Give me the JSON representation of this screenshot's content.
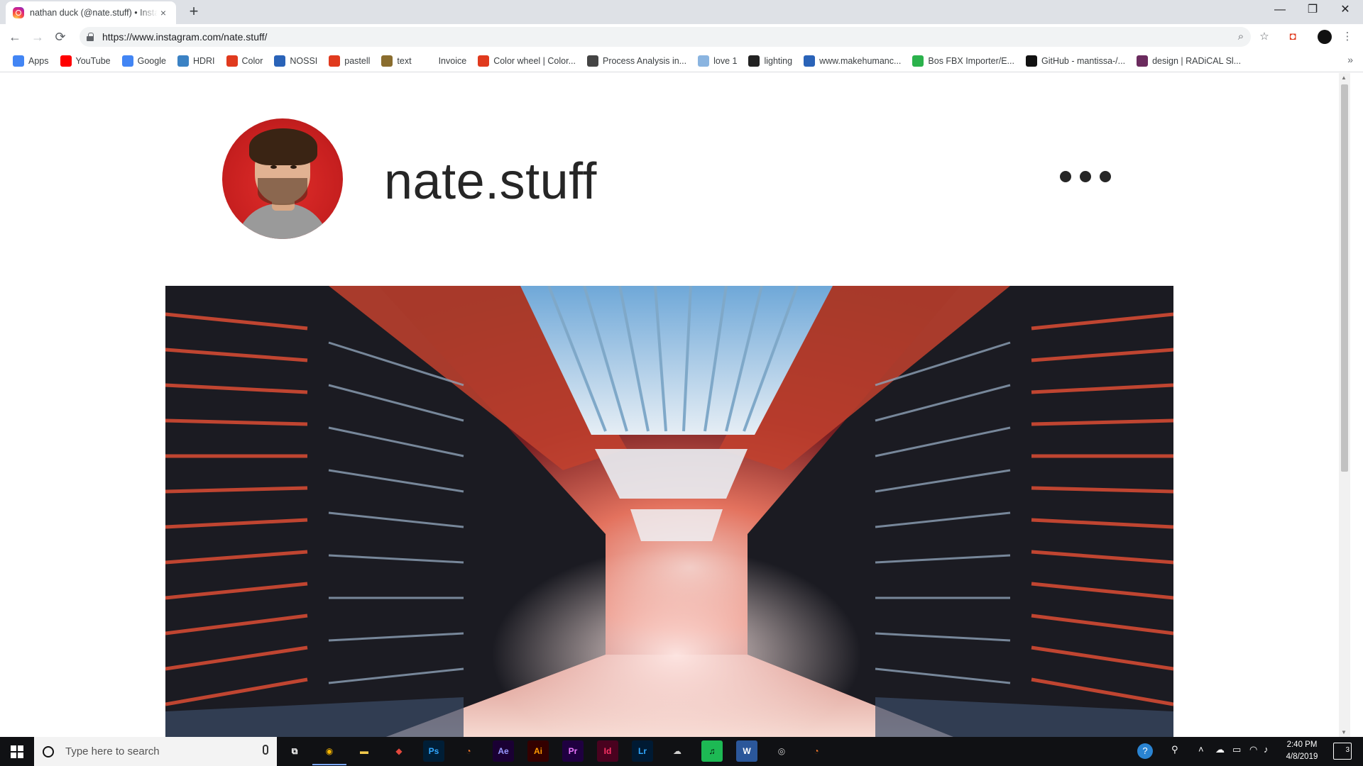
{
  "browser": {
    "tab_title": "nathan duck (@nate.stuff) • Instagram photos and videos",
    "new_tab": "+",
    "tab_close": "×",
    "url": "https://www.instagram.com/nate.stuff/",
    "window_controls": {
      "minimize": "—",
      "restore": "❐",
      "close": "✕"
    },
    "nav": {
      "back": "←",
      "forward": "→",
      "reload": "⟳"
    },
    "toolbar_icons": {
      "zoom": "⌕",
      "star": "☆",
      "extension": "◘",
      "menu": "⋮"
    }
  },
  "bookmarks": [
    {
      "label": "Apps",
      "icon": "apps-grid-icon",
      "color": "#4285f4"
    },
    {
      "label": "YouTube",
      "icon": "youtube-icon",
      "color": "#ff0000"
    },
    {
      "label": "Google",
      "icon": "google-icon",
      "color": "#4285f4"
    },
    {
      "label": "HDRI",
      "icon": "hdri-icon",
      "color": "#3b82c4"
    },
    {
      "label": "Color",
      "icon": "adobe-icon",
      "color": "#e03a1e"
    },
    {
      "label": "NOSSI",
      "icon": "nossi-icon",
      "color": "#2a63b8"
    },
    {
      "label": "pastell",
      "icon": "adobe-icon",
      "color": "#e03a1e"
    },
    {
      "label": "text",
      "icon": "text-icon",
      "color": "#8a6d2e"
    },
    {
      "label": "Invoice",
      "icon": "blank-icon",
      "color": "#ffffff"
    },
    {
      "label": "Color wheel | Color...",
      "icon": "adobe-icon",
      "color": "#e03a1e"
    },
    {
      "label": "Process Analysis in...",
      "icon": "process-icon",
      "color": "#444444"
    },
    {
      "label": "love 1",
      "icon": "heart-icon",
      "color": "#8ab4e0"
    },
    {
      "label": "lighting",
      "icon": "lighting-icon",
      "color": "#222222"
    },
    {
      "label": "www.makehumanc...",
      "icon": "makehuman-icon",
      "color": "#2a63b8"
    },
    {
      "label": "Bos FBX Importer/E...",
      "icon": "bos-icon",
      "color": "#2bb24c"
    },
    {
      "label": "GitHub - mantissa-/...",
      "icon": "github-icon",
      "color": "#111111"
    },
    {
      "label": "design | RADiCAL Sl...",
      "icon": "radical-icon",
      "color": "#6b2b5e"
    }
  ],
  "bookmarks_more": "»",
  "profile": {
    "username": "nate.stuff",
    "options_icon": "more-options-icon"
  },
  "taskbar": {
    "search_placeholder": "Type here to search",
    "apps": [
      {
        "name": "task-view",
        "label": "⧉",
        "bg": "transparent",
        "fg": "#ffffff"
      },
      {
        "name": "chrome",
        "label": "◉",
        "bg": "transparent",
        "fg": "#f4b400",
        "active": true
      },
      {
        "name": "file-explorer",
        "label": "▬",
        "bg": "transparent",
        "fg": "#f2c94c"
      },
      {
        "name": "substance",
        "label": "◆",
        "bg": "transparent",
        "fg": "#e2483d"
      },
      {
        "name": "photoshop",
        "label": "Ps",
        "bg": "#001e36",
        "fg": "#31a8ff"
      },
      {
        "name": "blender",
        "label": "◔",
        "bg": "transparent",
        "fg": "#f5792a"
      },
      {
        "name": "after-effects",
        "label": "Ae",
        "bg": "#1a0033",
        "fg": "#9999ff"
      },
      {
        "name": "illustrator",
        "label": "Ai",
        "bg": "#330000",
        "fg": "#ff9a00"
      },
      {
        "name": "premiere",
        "label": "Pr",
        "bg": "#1f0040",
        "fg": "#ea77ff"
      },
      {
        "name": "indesign",
        "label": "Id",
        "bg": "#49021f",
        "fg": "#ff3366"
      },
      {
        "name": "lightroom",
        "label": "Lr",
        "bg": "#001a33",
        "fg": "#31a8ff"
      },
      {
        "name": "app-cloud",
        "label": "☁",
        "bg": "transparent",
        "fg": "#d0d0d0"
      },
      {
        "name": "spotify",
        "label": "♫",
        "bg": "#1db954",
        "fg": "#000000"
      },
      {
        "name": "word",
        "label": "W",
        "bg": "#2b579a",
        "fg": "#ffffff"
      },
      {
        "name": "obs",
        "label": "◎",
        "bg": "transparent",
        "fg": "#d0d0d0"
      },
      {
        "name": "blender-2",
        "label": "◔",
        "bg": "transparent",
        "fg": "#f5792a"
      }
    ],
    "clock_time": "2:40 PM",
    "clock_date": "4/8/2019",
    "notification_count": "3"
  }
}
